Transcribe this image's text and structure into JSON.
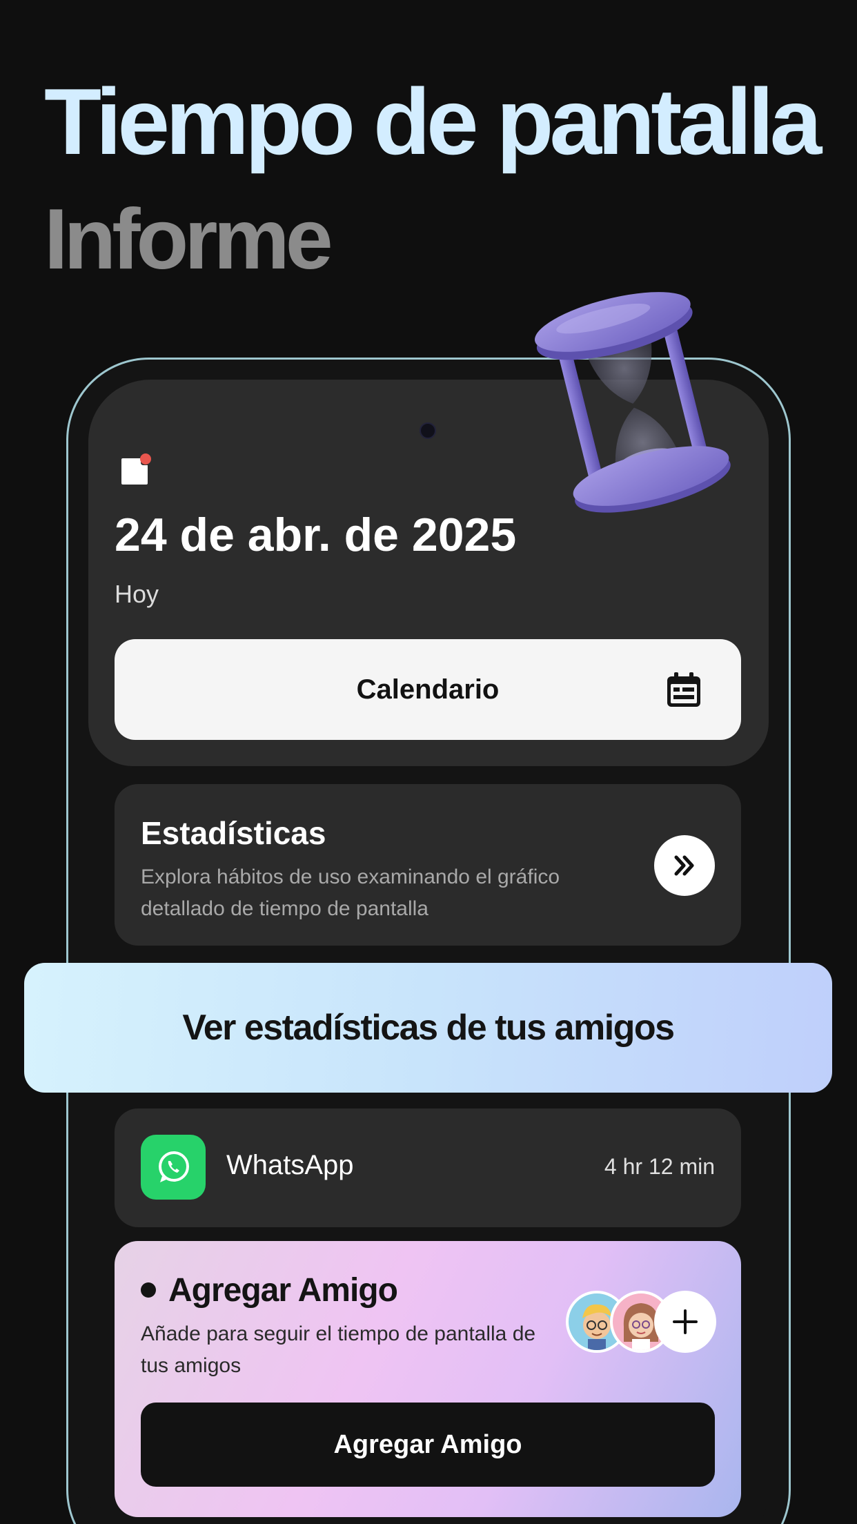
{
  "hero": {
    "title": "Tiempo de pantalla",
    "subtitle": "Informe"
  },
  "header_card": {
    "date": "24 de abr. de 2025",
    "day_label": "Hoy",
    "calendar_button": "Calendario",
    "calendar_icon": "calendar-icon",
    "note_icon": "note-icon"
  },
  "stats": {
    "title": "Estadísticas",
    "description": "Explora hábitos de uso examinando el gráfico detallado de tiempo de pantalla",
    "action_icon": "double-chevron-right-icon"
  },
  "banner": {
    "label": "Ver estadísticas de tus amigos"
  },
  "app_usage": {
    "app_name": "WhatsApp",
    "time": "4 hr 12 min",
    "icon": "whatsapp-icon",
    "icon_color": "#27d26a"
  },
  "add_friend": {
    "title": "Agregar Amigo",
    "description": "Añade para seguir el tiempo de pantalla de tus amigos",
    "button_label": "Agregar Amigo",
    "plus_icon": "plus-icon"
  },
  "colors": {
    "background": "#0f0f0f",
    "hero_title": "#d3edff",
    "hero_subtitle": "#8b8b8b",
    "card": "#2c2c2c",
    "accent_purple": "#8b80d6"
  }
}
